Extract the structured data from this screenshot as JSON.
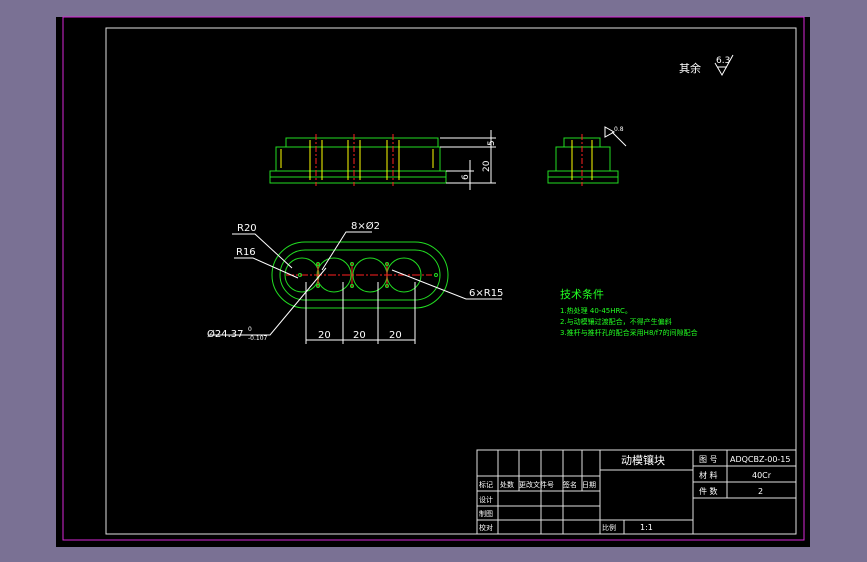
{
  "surface_finish": {
    "prefix": "其余",
    "value": "6.3"
  },
  "side_view": {
    "dim_top": "5",
    "dim_mid": "20",
    "dim_bottom": "6"
  },
  "end_view": {
    "roughness": "0.8"
  },
  "plan_view": {
    "label_r20": "R20",
    "label_r16": "R16",
    "label_holes": "8×Ø2",
    "label_r15": "6×R15",
    "label_dia": "Ø24.37",
    "tol_upper": "0",
    "tol_lower": "-0.107",
    "spacings": [
      "20",
      "20",
      "20"
    ]
  },
  "tech_requirements": {
    "title": "技术条件",
    "items": [
      "1.热处理 40-45HRC。",
      "2.与动模镶过渡配合，不得产生偏斜",
      "3.推杆与推杆孔的配合采用H8/f7的间隙配合"
    ]
  },
  "title_block": {
    "part_name": "动模镶块",
    "drawing_no_label": "图  号",
    "drawing_no": "ADQCBZ-00-15",
    "material_label": "材  料",
    "material": "40Cr",
    "qty_label": "件  数",
    "qty": "2",
    "rev_headers": [
      "标记",
      "处数",
      "更改文件号",
      "签名",
      "日期"
    ],
    "design": "设计",
    "draft": "制图",
    "check": "校对",
    "scale_label": "比例",
    "scale": "1:1"
  },
  "colors": {
    "canvas": "#000000",
    "outer_bg": "#7a7194",
    "border": "#c8c8c8",
    "part": "#22dd22",
    "hidden": "#ffff00",
    "center": "#ff2020",
    "dim": "#ffffff",
    "note": "#22ff22",
    "frame_magenta": "#d828d8"
  }
}
